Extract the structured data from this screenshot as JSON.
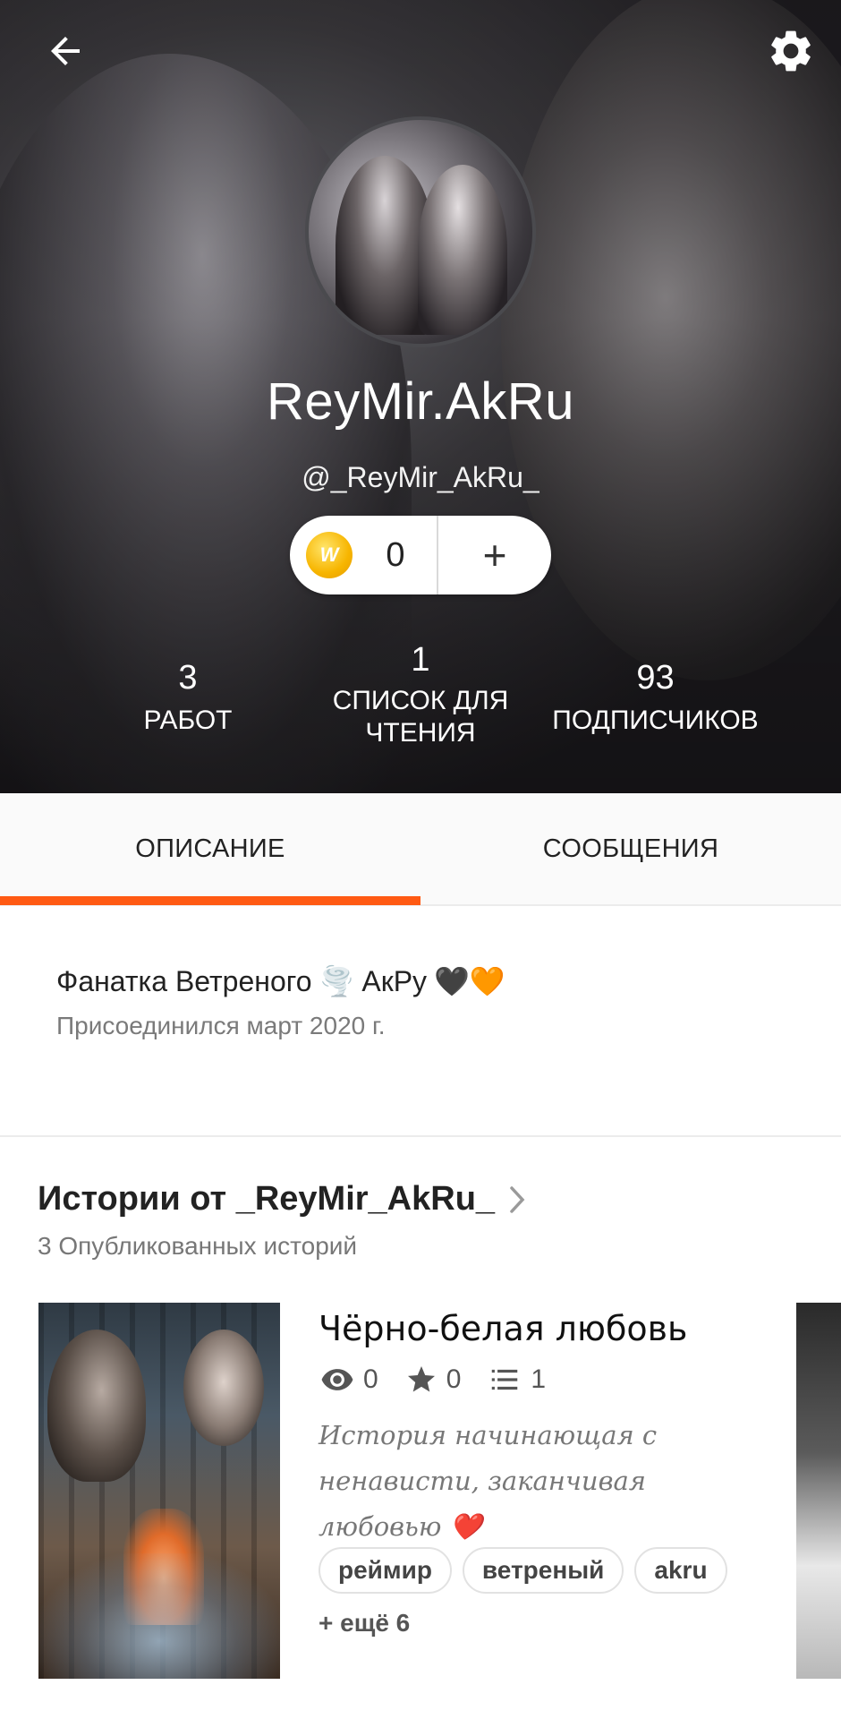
{
  "header": {
    "profile_name": "ReyMir.AkRu",
    "handle": "@_ReyMir_AkRu_",
    "coins": {
      "count": "0",
      "plus_label": "+",
      "coin_glyph": "W"
    },
    "stats": {
      "works": {
        "value": "3",
        "label": "РАБОТ"
      },
      "reading_list": {
        "value": "1",
        "label": "СПИСОК ДЛЯ\nЧТЕНИЯ"
      },
      "followers": {
        "value": "93",
        "label": "ПОДПИСЧИКОВ"
      }
    }
  },
  "tabs": [
    {
      "label": "ОПИСАНИЕ",
      "active": true
    },
    {
      "label": "СООБЩЕНИЯ",
      "active": false
    }
  ],
  "about": {
    "bio_text": "Фанатка Ветреного",
    "bio_emoji_1": "🌪️",
    "bio_text_2": "АкРу",
    "bio_emoji_2": "🖤🧡",
    "joined": "Присоединился март 2020 г."
  },
  "stories": {
    "title": "Истории от _ReyMir_AkRu_",
    "subtitle": "3 Опубликованных историй",
    "items": [
      {
        "title": "Чёрно-белая любовь",
        "views": "0",
        "votes": "0",
        "parts": "1",
        "description": "История начинающая с ненависти, заканчивая любовью ❤️",
        "tags": [
          "реймир",
          "ветреный",
          "akru"
        ],
        "more_tags": "+ ещё 6"
      }
    ]
  },
  "colors": {
    "accent": "#ff5a13",
    "coin": "#f7b500"
  }
}
